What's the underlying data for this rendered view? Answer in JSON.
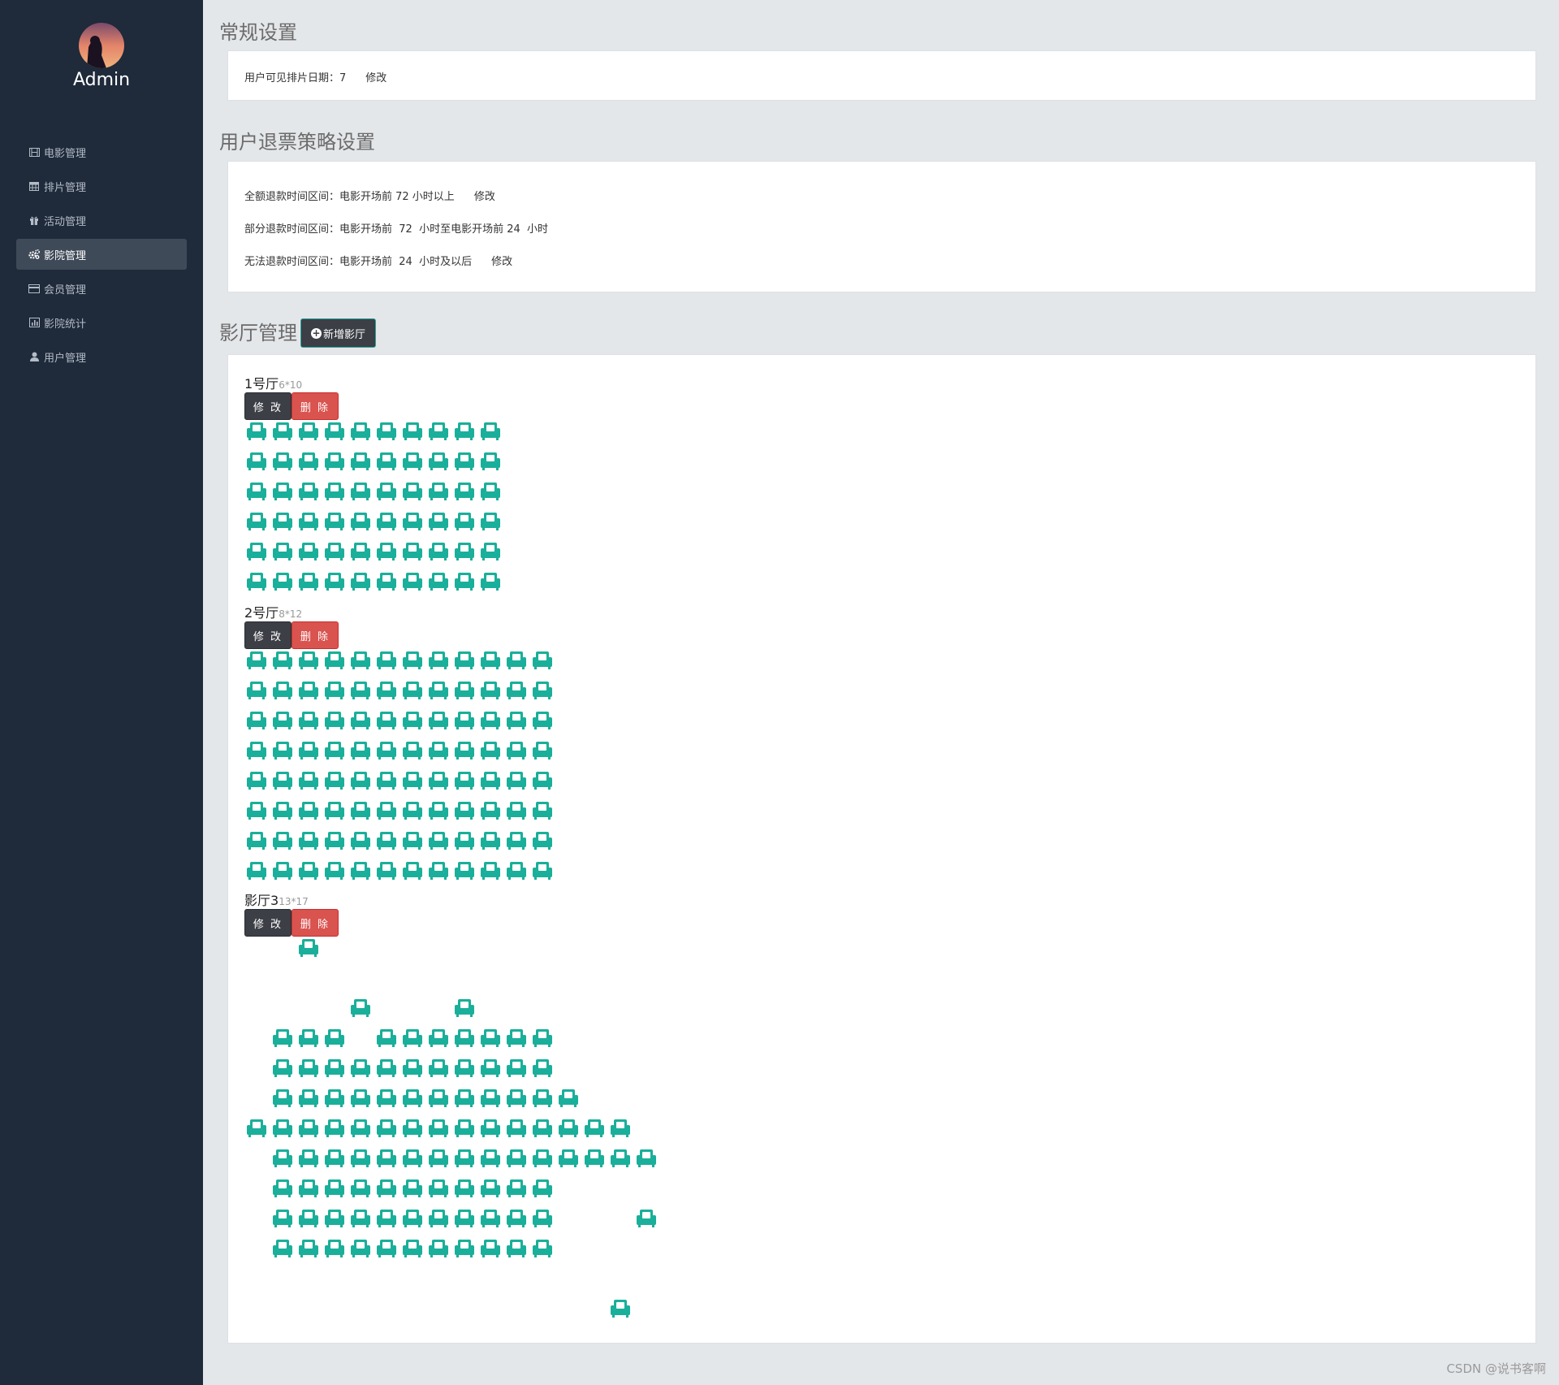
{
  "sidebar": {
    "admin_name": "Admin",
    "menu": [
      {
        "label": "电影管理",
        "icon": "film-icon",
        "active": false
      },
      {
        "label": "排片管理",
        "icon": "calendar-icon",
        "active": false
      },
      {
        "label": "活动管理",
        "icon": "gift-icon",
        "active": false
      },
      {
        "label": "影院管理",
        "icon": "cogs-icon",
        "active": true
      },
      {
        "label": "会员管理",
        "icon": "credit-card-icon",
        "active": false
      },
      {
        "label": "影院统计",
        "icon": "bar-chart-icon",
        "active": false
      },
      {
        "label": "用户管理",
        "icon": "user-icon",
        "active": false
      }
    ]
  },
  "general": {
    "title": "常规设置",
    "visible_days_label": "用户可见排片日期：7",
    "edit": "修改"
  },
  "refund": {
    "title": "用户退票策略设置",
    "full": "全额退款时间区间：电影开场前 72 小时以上",
    "partial": "部分退款时间区间：电影开场前  72  小时至电影开场前 24  小时",
    "none": "无法退款时间区间：电影开场前  24  小时及以后",
    "edit": "修改"
  },
  "halls_section": {
    "title": "影厅管理",
    "add_button": "新增影厅"
  },
  "halls": [
    {
      "name": "1号厅",
      "size": "6*10",
      "edit": "修 改",
      "delete": "删 除",
      "seat_rows": [
        "1111111111",
        "1111111111",
        "1111111111",
        "1111111111",
        "1111111111",
        "1111111111"
      ]
    },
    {
      "name": "2号厅",
      "size": "8*12",
      "edit": "修 改",
      "delete": "删 除",
      "seat_rows": [
        "111111111111",
        "111111111111",
        "111111111111",
        "111111111111",
        "111111111111",
        "111111111111",
        "111111111111",
        "111111111111"
      ]
    },
    {
      "name": "影厅3",
      "size": "13*17",
      "edit": "修 改",
      "delete": "删 除",
      "seat_rows": [
        "00100000000000000",
        "00000000000000000",
        "00001000100000000",
        "01110111111100000",
        "01111111111100000",
        "01111111111110000",
        "11111111111111100",
        "01111111111111110",
        "01111111111100000",
        "01111111111100010",
        "01111111111100000",
        "00000000000000000",
        "00000000000000100"
      ]
    }
  ],
  "colors": {
    "seat": "#1aaf9a",
    "sidebar_bg": "#1f2a3a",
    "page_bg": "#e4e7ea"
  },
  "watermark": "CSDN @说书客啊"
}
